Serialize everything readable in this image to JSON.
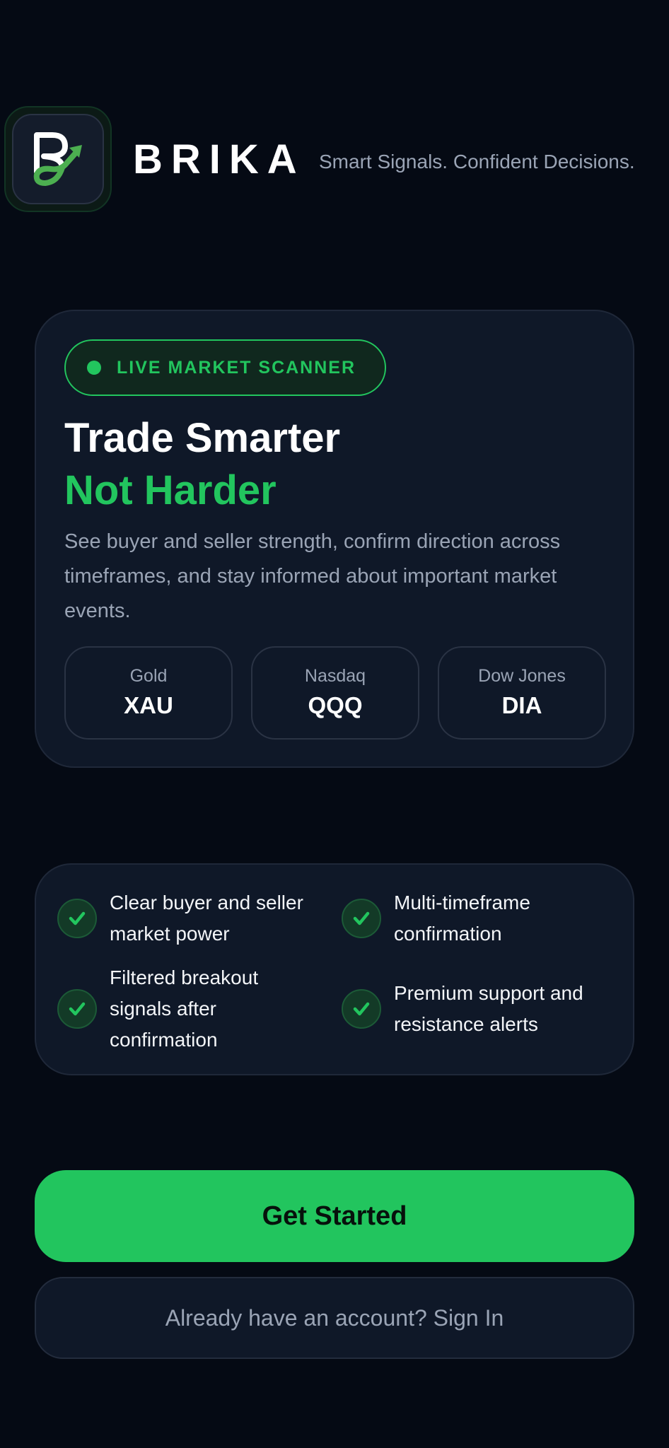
{
  "header": {
    "brand_name": "BRIKA",
    "tagline": "Smart Signals. Confident Decisions.",
    "logo_icon": "brika-logo-b-arrow-icon"
  },
  "hero": {
    "badge_label": "LIVE MARKET SCANNER",
    "headline_line1": "Trade Smarter",
    "headline_line2": "Not Harder",
    "description": "See buyer and seller strength, confirm direction across timeframes, and stay informed about important market events.",
    "markets": [
      {
        "name": "Gold",
        "ticker": "XAU"
      },
      {
        "name": "Nasdaq",
        "ticker": "QQQ"
      },
      {
        "name": "Dow Jones",
        "ticker": "DIA"
      }
    ]
  },
  "features": [
    {
      "text": "Clear buyer and seller market power",
      "icon": "check-icon"
    },
    {
      "text": "Multi-timeframe confirmation",
      "icon": "check-icon"
    },
    {
      "text": "Filtered breakout signals after confirmation",
      "icon": "check-icon"
    },
    {
      "text": "Premium support and resistance alerts",
      "icon": "check-icon"
    }
  ],
  "actions": {
    "primary_label": "Get Started",
    "secondary_label": "Already have an account? Sign In"
  },
  "colors": {
    "background": "#050a14",
    "card": "#0f1828",
    "accent": "#22c55e",
    "muted_text": "#9aa4b5"
  }
}
